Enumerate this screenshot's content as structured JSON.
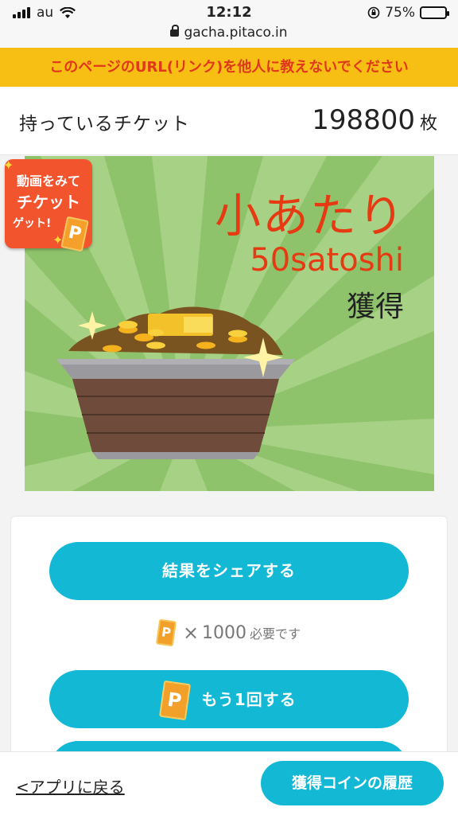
{
  "status_bar": {
    "carrier": "au",
    "time": "12:12",
    "battery_percent": "75%",
    "battery_level": 0.75,
    "url": "gacha.pitaco.in"
  },
  "warning_text": "このページのURL(リンク)を他人に教えないでください",
  "tickets": {
    "label": "持っているチケット",
    "count": "198800",
    "unit": "枚"
  },
  "prize": {
    "title": "小あたり",
    "amount": "50satoshi",
    "suffix": "獲得"
  },
  "video_badge": {
    "line1": "動画をみて",
    "line2": "チケット",
    "line3": "ゲット!",
    "ticket_letter": "P"
  },
  "actions": {
    "share_label": "結果をシェアする",
    "cost_ticket_letter": "P",
    "cost_times": "×",
    "cost_amount": "1000",
    "cost_note": "必要です",
    "again_label": "もう1回する",
    "again_ticket_letter": "P"
  },
  "footer": {
    "back_label": "<アプリに戻る",
    "history_label": "獲得コインの履歴"
  },
  "colors": {
    "accent": "#12b8d4",
    "warning_bg": "#f7bf14",
    "warning_text": "#e0381b",
    "prize_red": "#e63b12",
    "banner_green": "#8fc36b"
  }
}
